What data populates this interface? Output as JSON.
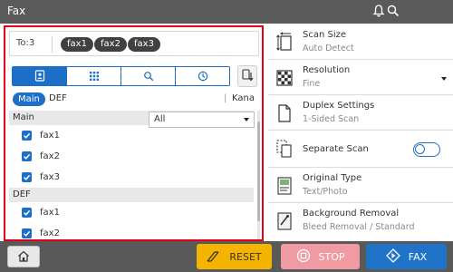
{
  "header": {
    "title": "Fax",
    "icons": [
      "bell-icon",
      "search-icon"
    ]
  },
  "destination": {
    "label": "To:3",
    "recipients": [
      "fax1",
      "fax2",
      "fax3"
    ]
  },
  "address_tabs": [
    "address-book-icon",
    "keypad-icon",
    "search-icon",
    "history-icon"
  ],
  "index": {
    "main": "Main",
    "def": "DEF",
    "separator": "|",
    "kana": "Kana"
  },
  "filter": {
    "selected": "All"
  },
  "address_list": {
    "groups": [
      {
        "name": "Main",
        "items": [
          "fax1",
          "fax2",
          "fax3"
        ]
      },
      {
        "name": "DEF",
        "items": [
          "fax1",
          "fax2"
        ]
      }
    ]
  },
  "settings": [
    {
      "title": "Scan Size",
      "value": "Auto Detect",
      "icon": "scan-size-icon"
    },
    {
      "title": "Resolution",
      "value": "Fine",
      "icon": "resolution-icon"
    },
    {
      "title": "Duplex Settings",
      "value": "1-Sided Scan",
      "icon": "duplex-icon"
    },
    {
      "title": "Separate Scan",
      "value": "",
      "icon": "separate-scan-icon",
      "toggle": false
    },
    {
      "title": "Original Type",
      "value": "Text/Photo",
      "icon": "original-type-icon"
    },
    {
      "title": "Background Removal",
      "value": "Bleed Removal / Standard",
      "icon": "background-removal-icon"
    }
  ],
  "bottom": {
    "reset": "RESET",
    "stop": "STOP",
    "fax": "FAX"
  },
  "colors": {
    "accent": "#1b6fc7",
    "reset": "#f5b400",
    "stop": "#f09aa2",
    "fax": "#1f74c9",
    "selection_border": "#e3001b"
  }
}
